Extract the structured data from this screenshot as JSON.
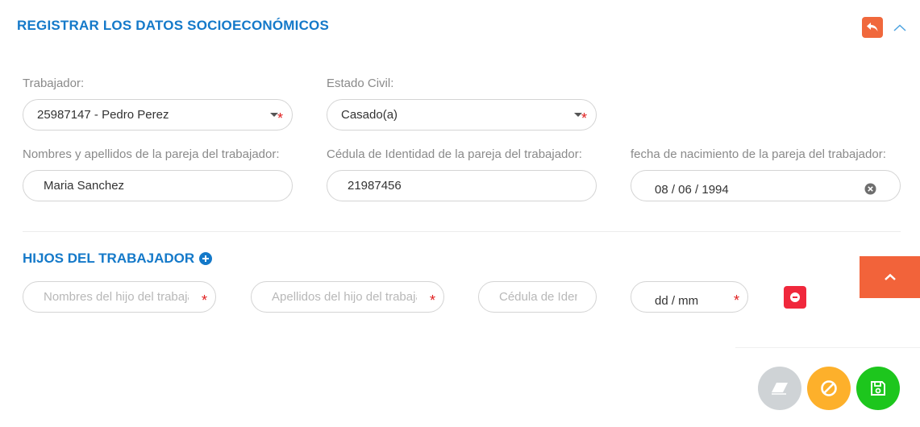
{
  "header": {
    "title": "REGISTRAR LOS DATOS SOCIOECONÓMICOS",
    "back_icon": "reply-icon",
    "collapse_icon": "chevron-up-icon"
  },
  "form": {
    "trabajador": {
      "label": "Trabajador:",
      "value": "25987147 - Pedro Perez"
    },
    "estado_civil": {
      "label": "Estado Civil:",
      "value": "Casado(a)"
    },
    "pareja_nombre": {
      "label": "Nombres y apellidos de la pareja del trabajador:",
      "value": "Maria Sanchez"
    },
    "pareja_cedula": {
      "label": "Cédula de Identidad de la pareja del trabajador:",
      "value": "21987456"
    },
    "pareja_fecha": {
      "label": "fecha de nacimiento de la pareja del trabajador:",
      "value": "08 / 06 / 1994"
    }
  },
  "hijos": {
    "title": "HIJOS DEL TRABAJADOR",
    "nombres_placeholder": "Nombres del hijo del trabajador",
    "apellidos_placeholder": "Apellidos del hijo del trabajador",
    "cedula_placeholder": "Cédula de Identidad",
    "fecha_placeholder": "dd / mm"
  },
  "actions": {
    "clear_icon": "eraser-icon",
    "cancel_icon": "ban-icon",
    "save_icon": "save-icon"
  },
  "colors": {
    "accent_blue": "#1479c9",
    "orange": "#f0683c",
    "red": "#f0283c",
    "gray_btn": "#cfd3d6",
    "yellow_btn": "#fdb02b",
    "green_btn": "#1dc61d"
  }
}
